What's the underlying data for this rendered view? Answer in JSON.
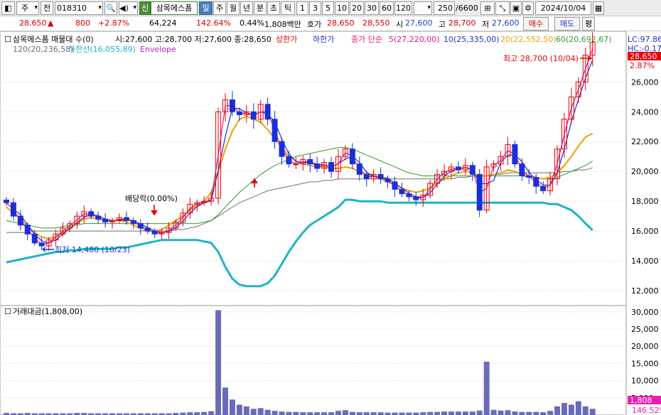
{
  "toolbar": {
    "market_select": "주",
    "prev_label": "전",
    "code": "018310",
    "period_badge": "신",
    "stock_name": "삼목에스폼",
    "periods": [
      "일",
      "주",
      "월",
      "년",
      "분",
      "초",
      "틱"
    ],
    "active_period": "일",
    "minutes": [
      "1",
      "3",
      "5",
      "10",
      "20",
      "30",
      "60",
      "120"
    ],
    "count": "250",
    "count_total": "/6600",
    "date": "2024/10/04"
  },
  "quote": {
    "price": "28,650",
    "change": "800",
    "change_pct": "+2.87%",
    "volume": "64,224",
    "volume_ratio": "142.64%",
    "turnover_pct": "0.44%",
    "amount": "1,808백만",
    "ask_label": "호가",
    "ask": "28,650",
    "bid": "28,550",
    "open_label": "시",
    "open": "27,600",
    "high_label": "고",
    "high": "28,700",
    "low_label": "저",
    "low": "27,600",
    "buy_label": "매수",
    "sell_label": "매도",
    "avg_label": "평"
  },
  "legend": {
    "title": "삼목에스폼 매물대 수(0)",
    "ohlc": "시:27,600 고:28,700 저:27,600 종:28,650",
    "upper_limit": "상한가",
    "lower_limit": "하한가",
    "ma_simple": "종가 단순",
    "ma5": "5(27,220,00)",
    "ma10": "10(25,335,00)",
    "ma20": "20(22,552,50)",
    "ma60": "60(20,692,67)",
    "ma120": "120(20,236,58)",
    "lower_band": "하한선(16,055,89)",
    "envelope": "Envelope",
    "lc": "LC:97.86",
    "hc": "HC:-0.17",
    "price_tag": "28,650",
    "pct_tag": "2.87%",
    "high_annot": "최고 28,700 (10/04)",
    "low_annot": "최저 14,480 (10/23)",
    "dividend": "배당락(0.00%)",
    "volume_title": "거래대금(1,808,00)",
    "vol_tag": "1,808",
    "vol_pct_tag": "146.52%"
  },
  "colors": {
    "up": "#e8000b",
    "down": "#1c2fd6",
    "ma5": "#e8187a",
    "ma10": "#1c2fd6",
    "ma20": "#f0a000",
    "ma60": "#2f9a2f",
    "ma120": "#707070",
    "envelope": "#1fb3c9",
    "volume": "#6a6ab8"
  },
  "chart_data": {
    "type": "candlestick",
    "title": "삼목에스폼",
    "y_axis_ticks": [
      "26,000",
      "24,000",
      "22,000",
      "20,000",
      "18,000",
      "16,000",
      "14,000",
      "12,000"
    ],
    "ylim": [
      11000,
      29400
    ],
    "volume_ticks": [
      "30,000",
      "25,000",
      "20,000",
      "15,000",
      "10,000",
      "5,000"
    ],
    "volume_ylim": [
      0,
      31000
    ],
    "close_path": [
      17900,
      17000,
      16400,
      15800,
      15200,
      15000,
      15400,
      15800,
      16200,
      16500,
      17000,
      17300,
      17000,
      16800,
      16600,
      16700,
      16900,
      16700,
      16500,
      16200,
      16000,
      15800,
      15900,
      16200,
      16600,
      17200,
      17800,
      17900,
      18000,
      18200,
      24000,
      24800,
      24000,
      23800,
      24000,
      23500,
      24500,
      23500,
      22000,
      21000,
      20500,
      20500,
      20800,
      20500,
      20200,
      20600,
      20000,
      21000,
      21500,
      20500,
      19800,
      19500,
      19800,
      19500,
      19300,
      18800,
      18500,
      18300,
      18100,
      18400,
      19200,
      19800,
      20000,
      20300,
      20100,
      20400,
      19800,
      17400,
      20300,
      20500,
      21000,
      21800,
      20500,
      19700,
      19600,
      19000,
      18700,
      19500,
      21500,
      23500,
      25000,
      26000,
      27800,
      28650
    ],
    "ma20_path": [
      17600,
      17200,
      16800,
      16300,
      15900,
      15600,
      15500,
      15600,
      15900,
      16200,
      16500,
      16800,
      16900,
      16800,
      16700,
      16700,
      16700,
      16600,
      16400,
      16200,
      16000,
      16000,
      16100,
      16400,
      16700,
      17000,
      17400,
      17700,
      18000,
      18600,
      20000,
      21500,
      22700,
      23500,
      23700,
      23500,
      23300,
      22800,
      22200,
      21600,
      21000,
      20700,
      20500,
      20400,
      20300,
      20300,
      20200,
      20200,
      20300,
      20200,
      20000,
      19800,
      19700,
      19500,
      19300,
      19100,
      18900,
      18700,
      18600,
      18700,
      18900,
      19200,
      19500,
      19700,
      19900,
      20000,
      19900,
      19700,
      19700,
      19800,
      19900,
      20100,
      20000,
      19800,
      19700,
      19600,
      19500,
      19600,
      19900,
      20400,
      21000,
      21700,
      22300,
      22550
    ],
    "ma60_path": [
      16700,
      16600,
      16500,
      16400,
      16300,
      16200,
      16200,
      16200,
      16300,
      16400,
      16400,
      16500,
      16500,
      16500,
      16500,
      16500,
      16500,
      16500,
      16500,
      16500,
      16500,
      16500,
      16500,
      16500,
      16500,
      16500,
      16500,
      16500,
      16600,
      16700,
      17100,
      17600,
      18100,
      18600,
      19000,
      19400,
      19800,
      20100,
      20400,
      20600,
      20800,
      21000,
      21100,
      21200,
      21300,
      21400,
      21500,
      21600,
      21600,
      21500,
      21300,
      21100,
      20900,
      20700,
      20500,
      20300,
      20100,
      19900,
      19800,
      19700,
      19700,
      19700,
      19700,
      19700,
      19700,
      19700,
      19700,
      19700,
      19700,
      19700,
      19700,
      19700,
      19700,
      19700,
      19600,
      19600,
      19500,
      19500,
      19600,
      19800,
      20000,
      20200,
      20400,
      20690
    ],
    "ma120_path": [
      15900,
      15900,
      15900,
      15900,
      16000,
      16000,
      16000,
      16000,
      16000,
      16000,
      16000,
      16000,
      16000,
      16000,
      16000,
      16000,
      16000,
      16000,
      16000,
      16000,
      16000,
      16000,
      16000,
      16000,
      16100,
      16100,
      16200,
      16300,
      16500,
      16700,
      17000,
      17300,
      17600,
      17900,
      18100,
      18300,
      18500,
      18700,
      18800,
      18900,
      19000,
      19100,
      19200,
      19300,
      19300,
      19400,
      19400,
      19500,
      19500,
      19500,
      19500,
      19500,
      19500,
      19500,
      19500,
      19500,
      19500,
      19500,
      19500,
      19500,
      19500,
      19500,
      19500,
      19500,
      19600,
      19600,
      19700,
      19700,
      19700,
      19800,
      19800,
      19900,
      19900,
      19900,
      19900,
      19900,
      19900,
      19900,
      19900,
      20000,
      20000,
      20100,
      20100,
      20240
    ],
    "lower_band_path": [
      13900,
      14000,
      14100,
      14200,
      14300,
      14400,
      14500,
      14600,
      14600,
      14700,
      14700,
      14800,
      14800,
      14800,
      14800,
      14800,
      14900,
      14900,
      15000,
      15100,
      15200,
      15300,
      15400,
      15400,
      15400,
      15400,
      15400,
      15400,
      15300,
      15200,
      14600,
      13600,
      12800,
      12400,
      12300,
      12300,
      12300,
      12500,
      13000,
      13800,
      14600,
      15300,
      15900,
      16400,
      16700,
      17000,
      17300,
      17600,
      18100,
      18100,
      18000,
      18000,
      18000,
      18000,
      17900,
      17900,
      17900,
      17900,
      17900,
      17900,
      17900,
      17900,
      17900,
      17900,
      17900,
      17900,
      17900,
      17900,
      17900,
      17900,
      17900,
      17900,
      17900,
      17900,
      17900,
      17900,
      17900,
      17800,
      17800,
      17600,
      17400,
      17000,
      16500,
      16060
    ],
    "volume_path": [
      0.6,
      0.5,
      0.5,
      0.6,
      0.5,
      0.5,
      0.5,
      0.5,
      0.5,
      0.5,
      0.6,
      0.6,
      0.5,
      0.5,
      0.5,
      0.5,
      0.5,
      0.5,
      0.5,
      0.5,
      0.5,
      0.5,
      0.5,
      0.5,
      0.6,
      0.7,
      0.8,
      0.8,
      0.9,
      1.1,
      30.5,
      8.0,
      4.5,
      3.0,
      2.5,
      1.8,
      2.0,
      1.5,
      1.2,
      1.0,
      0.9,
      0.9,
      0.8,
      0.8,
      0.8,
      0.8,
      0.8,
      1.2,
      1.4,
      0.9,
      0.8,
      0.8,
      0.8,
      0.8,
      0.7,
      0.7,
      0.7,
      0.7,
      0.7,
      0.8,
      0.9,
      0.9,
      1.0,
      1.0,
      1.0,
      1.0,
      1.0,
      1.3,
      15.5,
      1.5,
      1.3,
      1.4,
      1.0,
      0.9,
      0.9,
      0.9,
      0.8,
      1.2,
      2.5,
      3.5,
      3.0,
      4.0,
      2.5,
      1.8
    ]
  }
}
